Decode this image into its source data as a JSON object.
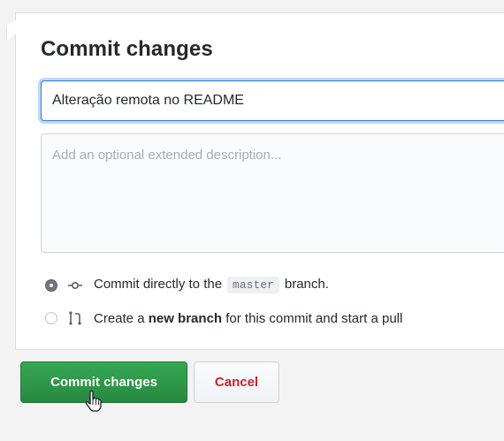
{
  "form": {
    "title": "Commit changes",
    "summary_value": "Alteração remota no README",
    "description_placeholder": "Add an optional extended description...",
    "options": [
      {
        "selected": true,
        "icon": "git-commit-icon",
        "text_before": "Commit directly to the",
        "branch": "master",
        "text_after": "branch."
      },
      {
        "selected": false,
        "icon": "git-pull-request-icon",
        "text_before": "Create a",
        "bold": "new branch",
        "text_after": "for this commit and start a pull"
      }
    ]
  },
  "buttons": {
    "commit_label": "Commit changes",
    "cancel_label": "Cancel"
  },
  "colors": {
    "primary_button": "#2ea44f",
    "cancel_text": "#cb2431",
    "focus_border": "#2f7de1"
  }
}
